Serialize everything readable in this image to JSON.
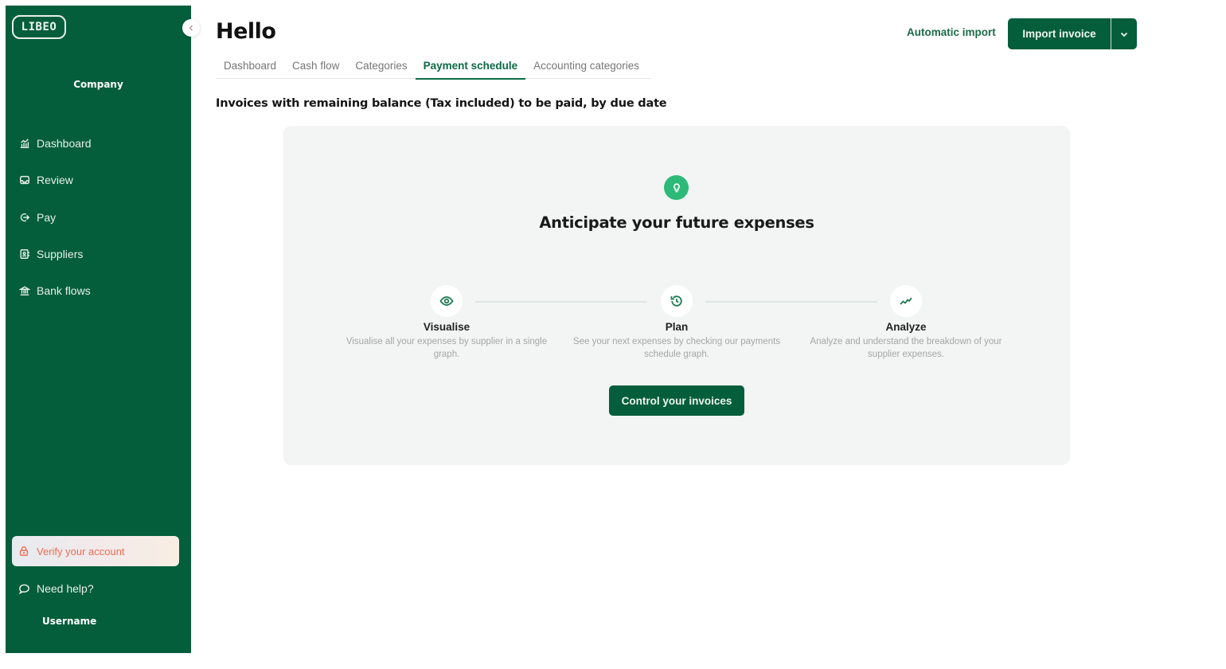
{
  "sidebar": {
    "logo": "LIBEO",
    "company": "Company",
    "items": [
      {
        "label": "Dashboard",
        "icon": "chart-bars-icon"
      },
      {
        "label": "Review",
        "icon": "inbox-icon"
      },
      {
        "label": "Pay",
        "icon": "arrow-exit-icon"
      },
      {
        "label": "Suppliers",
        "icon": "contact-book-icon"
      },
      {
        "label": "Bank flows",
        "icon": "bank-icon"
      }
    ],
    "verify_label": "Verify your account",
    "help_label": "Need help?",
    "username": "Username",
    "collapse_icon": "chevron-left-icon"
  },
  "header": {
    "title": "Hello",
    "tabs": [
      {
        "label": "Dashboard",
        "active": false
      },
      {
        "label": "Cash flow",
        "active": false
      },
      {
        "label": "Categories",
        "active": false
      },
      {
        "label": "Payment schedule",
        "active": true
      },
      {
        "label": "Accounting categories",
        "active": false
      }
    ],
    "automatic_import": "Automatic import",
    "import_invoice": "Import invoice"
  },
  "main": {
    "subtitle": "Invoices with remaining balance (Tax included) to be paid, by due date",
    "card": {
      "icon": "lightbulb-icon",
      "title": "Anticipate your future expenses",
      "steps": [
        {
          "title": "Visualise",
          "description": "Visualise all your expenses by supplier in a single graph.",
          "icon": "eye-icon"
        },
        {
          "title": "Plan",
          "description": "See your next expenses by checking our payments schedule graph.",
          "icon": "history-icon"
        },
        {
          "title": "Analyze",
          "description": "Analyze and understand the breakdown of your supplier expenses.",
          "icon": "trend-icon"
        }
      ],
      "cta_label": "Control your invoices"
    }
  },
  "colors": {
    "brand_green": "#055e3b",
    "accent_green": "#2dba78",
    "warning_orange": "#ee6d55"
  }
}
